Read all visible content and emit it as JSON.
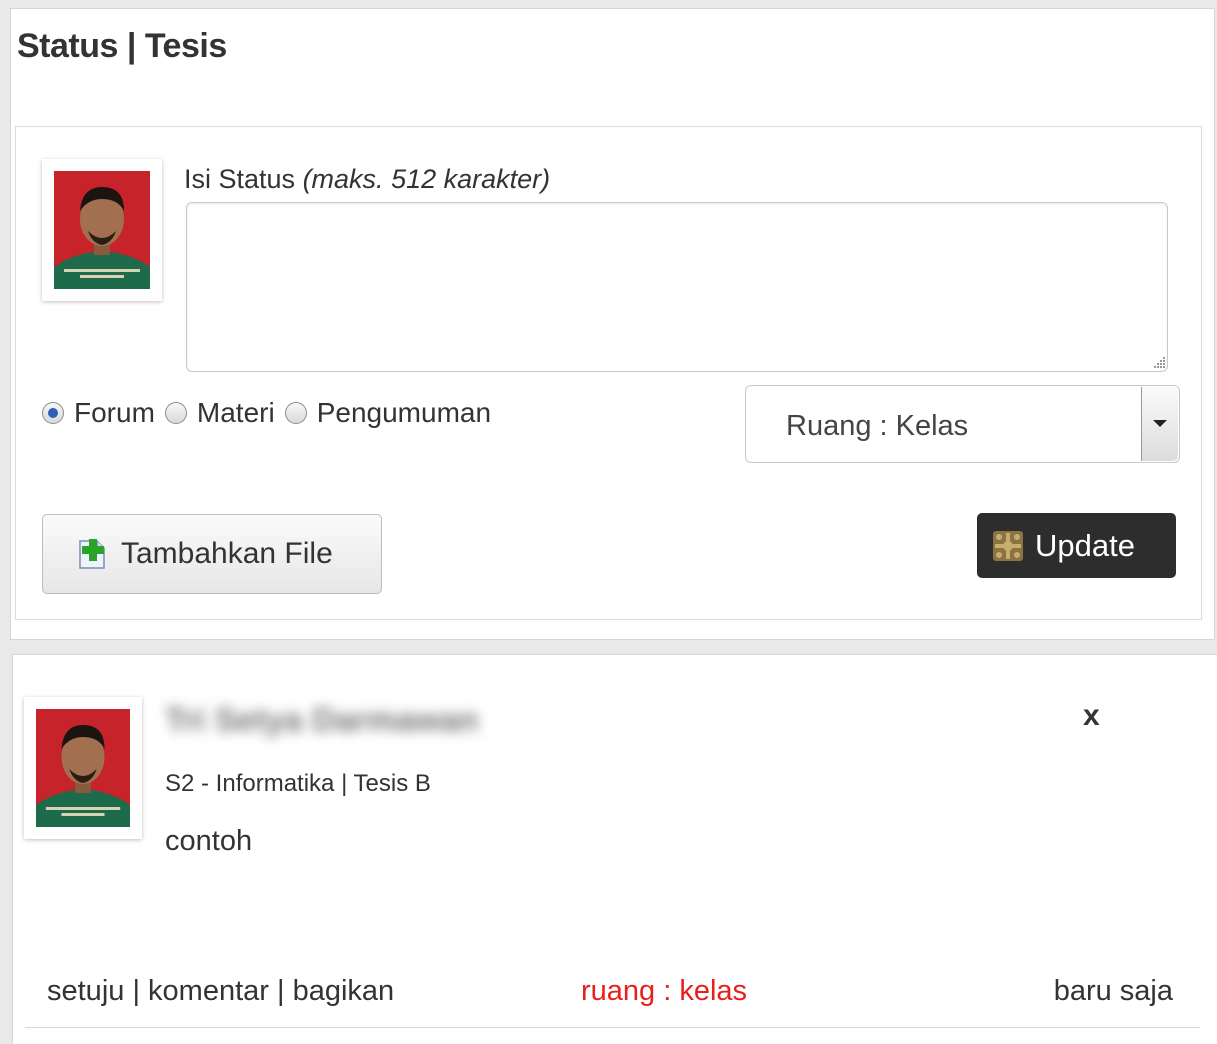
{
  "header": {
    "title": "Status | Tesis"
  },
  "form": {
    "label": "Isi Status",
    "label_hint": "(maks. 512 karakter)",
    "status_value": "",
    "radios": [
      {
        "label": "Forum",
        "checked": true
      },
      {
        "label": "Materi",
        "checked": false
      },
      {
        "label": "Pengumuman",
        "checked": false
      }
    ],
    "room_select": {
      "value": "Ruang : Kelas"
    },
    "add_file_label": "Tambahkan File",
    "update_label": "Update"
  },
  "post": {
    "author": "Tri Setya Darmawan",
    "meta": "S2 - Informatika | Tesis B",
    "content": "contoh",
    "close_label": "x",
    "actions": {
      "agree": "setuju",
      "comment": "komentar",
      "share": "bagikan",
      "separator": " | "
    },
    "room": "ruang : kelas",
    "time": "baru saja"
  },
  "colors": {
    "room_tag": "#e8201a",
    "update_bg": "#2d2d2d",
    "radio_selected": "#2c5fb3"
  }
}
